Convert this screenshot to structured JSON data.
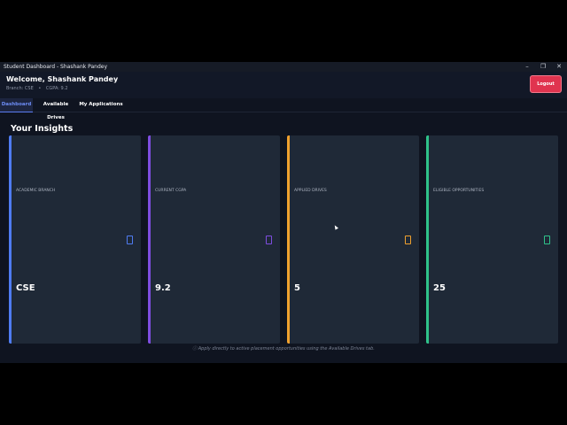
{
  "window": {
    "title": "Student Dashboard - Shashank Pandey",
    "minimize_glyph": "–",
    "maximize_glyph": "❐",
    "close_glyph": "✕"
  },
  "header": {
    "welcome": "Welcome, Shashank Pandey",
    "branch": "Branch: CSE",
    "separator": "•",
    "cgpa": "CGPA: 9.2",
    "logout_label": "Logout"
  },
  "tabs": [
    {
      "label": "Dashboard",
      "active": true
    },
    {
      "label": "Available Drives",
      "active": false
    },
    {
      "label": "My Applications",
      "active": false
    }
  ],
  "insights_title": "Your Insights",
  "cards": [
    {
      "label": "ACADEMIC BRANCH",
      "value": "CSE",
      "accent": "#4f7cf2",
      "icon": "square-outline-icon"
    },
    {
      "label": "CURRENT CGPA",
      "value": "9.2",
      "accent": "#7e4de0",
      "icon": "square-outline-icon"
    },
    {
      "label": "APPLIED DRIVES",
      "value": "5",
      "accent": "#f0a12e",
      "icon": "square-outline-icon"
    },
    {
      "label": "ELIGIBLE OPPORTUNITIES",
      "value": "25",
      "accent": "#2fc28a",
      "icon": "square-outline-icon"
    }
  ],
  "footer_note": "ⓘ Apply directly to active placement opportunities using the Available Drives tab."
}
